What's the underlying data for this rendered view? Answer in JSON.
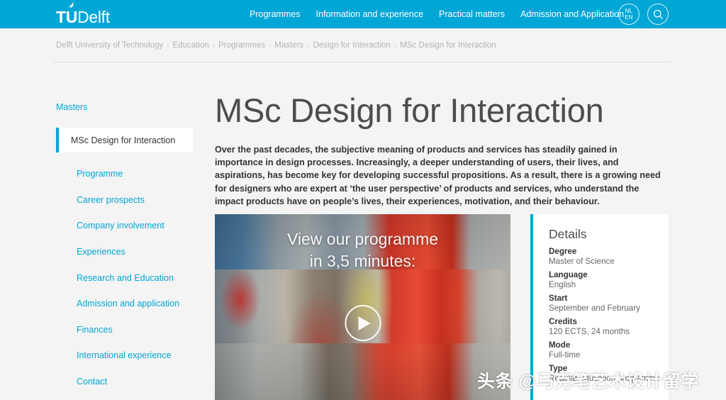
{
  "brand": {
    "primary_color": "#00a6d6",
    "logo_bold": "TU",
    "logo_light": "Delft",
    "logo_icon": "flame-icon"
  },
  "header": {
    "nav": [
      {
        "label": "Programmes"
      },
      {
        "label": "Information and experience"
      },
      {
        "label": "Practical matters"
      },
      {
        "label": "Admission and Application"
      }
    ],
    "language_toggle": {
      "inactive": "NL",
      "active": "EN"
    },
    "search_icon": "search-icon"
  },
  "breadcrumb": {
    "separator": "›",
    "items": [
      "Delft University of Technology",
      "Education",
      "Programmes",
      "Masters",
      "Design for Interaction",
      "MSc Design for Interaction"
    ]
  },
  "sidebar": {
    "parent": "Masters",
    "active_item": "MSc Design for Interaction",
    "items": [
      {
        "label": "Programme"
      },
      {
        "label": "Career prospects"
      },
      {
        "label": "Company involvement"
      },
      {
        "label": "Experiences"
      },
      {
        "label": "Research and Education"
      },
      {
        "label": "Admission and application"
      },
      {
        "label": "Finances"
      },
      {
        "label": "International experience"
      },
      {
        "label": "Contact"
      }
    ]
  },
  "main": {
    "title": "MSc Design for Interaction",
    "intro": "Over the past decades, the subjective meaning of products and services has steadily gained in importance in design processes. Increasingly, a deeper understanding of users, their lives, and aspirations, has become key for developing successful propositions. As a result, there is a growing need for designers who are expert at ‘the user perspective’ of products and services, who understand the impact products have on people’s lives, their experiences, motivation, and their behaviour."
  },
  "video": {
    "caption_line1": "View our programme",
    "caption_line2": "in 3,5 minutes:",
    "play_icon": "play-icon"
  },
  "details": {
    "heading": "Details",
    "rows": [
      {
        "label": "Degree",
        "value": "Master of Science"
      },
      {
        "label": "Language",
        "value": "English"
      },
      {
        "label": "Start",
        "value": "September and February"
      },
      {
        "label": "Credits",
        "value": "120 ECTS, 24 months"
      },
      {
        "label": "Mode",
        "value": "Full-time"
      },
      {
        "label": "Type",
        "value": "Regular education programme"
      }
    ]
  },
  "watermark": {
    "text": "头条 @马克笔艺术设计留学"
  }
}
